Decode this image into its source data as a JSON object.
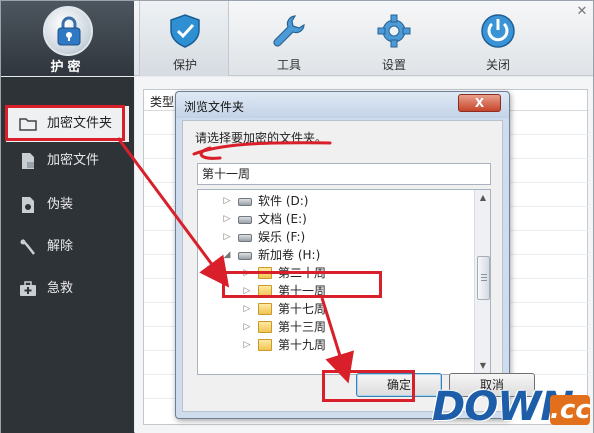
{
  "app": {
    "logo_label": "护密",
    "tabs": [
      {
        "label": "保护",
        "icon": "shield-icon",
        "active": true
      },
      {
        "label": "工具",
        "icon": "wrench-icon"
      },
      {
        "label": "设置",
        "icon": "gear-icon"
      },
      {
        "label": "关闭",
        "icon": "power-icon"
      }
    ],
    "close_glyph": "✕"
  },
  "sidebar": {
    "items": [
      {
        "label": "加密文件夹",
        "icon": "folder-icon",
        "selected": true
      },
      {
        "label": "加密文件",
        "icon": "file-lock-icon"
      },
      {
        "label": "伪装",
        "icon": "disguise-icon"
      },
      {
        "label": "解除",
        "icon": "unlock-icon"
      },
      {
        "label": "急救",
        "icon": "first-aid-icon"
      }
    ]
  },
  "main": {
    "column_header": "类型"
  },
  "dialog": {
    "title": "浏览文件夹",
    "close_glyph": "X",
    "prompt": "请选择要加密的文件夹。",
    "path_value": "第十一周",
    "tree": [
      {
        "label": "软件 (D:)",
        "type": "drive",
        "expanded": false
      },
      {
        "label": "文档 (E:)",
        "type": "drive",
        "expanded": false
      },
      {
        "label": "娱乐 (F:)",
        "type": "drive",
        "expanded": false
      },
      {
        "label": "新加卷 (H:)",
        "type": "drive",
        "expanded": true
      },
      {
        "label": "第二十周",
        "type": "folder"
      },
      {
        "label": "第十一周",
        "type": "folder",
        "selected": true
      },
      {
        "label": "第十七周",
        "type": "folder"
      },
      {
        "label": "第十三周",
        "type": "folder"
      },
      {
        "label": "第十九周",
        "type": "folder"
      }
    ],
    "ok_label": "确定",
    "cancel_label": "取消"
  },
  "watermark": {
    "text": "DOWN",
    "suffix": ".cc"
  },
  "colors": {
    "sidebar_bg": "#2e3338",
    "annotation_red": "#d9202a",
    "watermark_blue": "#1e5ea8",
    "watermark_orange": "#e26f1b"
  }
}
